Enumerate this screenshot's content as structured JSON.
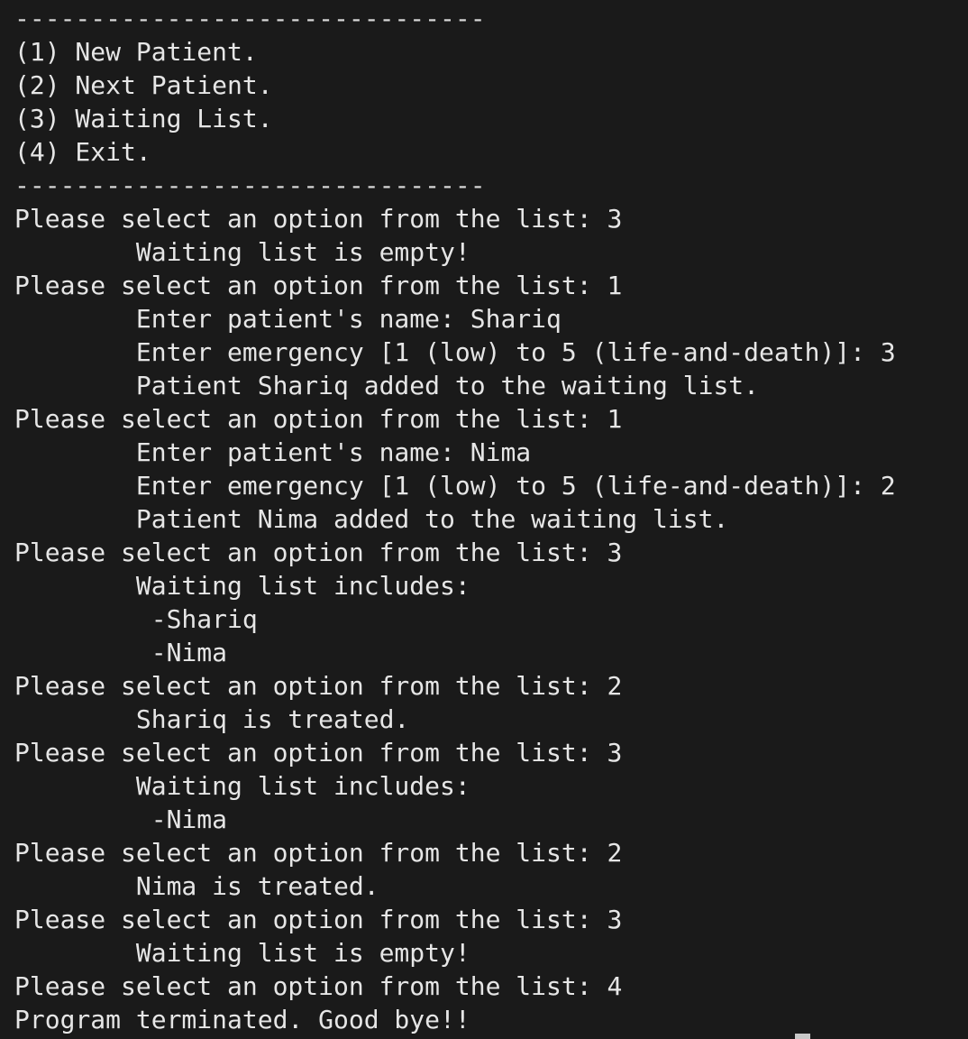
{
  "terminal": {
    "lines": [
      "-------------------------------",
      "(1) New Patient.",
      "(2) Next Patient.",
      "(3) Waiting List.",
      "(4) Exit.",
      "-------------------------------",
      "Please select an option from the list: 3",
      "        Waiting list is empty!",
      "Please select an option from the list: 1",
      "        Enter patient's name: Shariq",
      "        Enter emergency [1 (low) to 5 (life-and-death)]: 3",
      "        Patient Shariq added to the waiting list.",
      "Please select an option from the list: 1",
      "        Enter patient's name: Nima",
      "        Enter emergency [1 (low) to 5 (life-and-death)]: 2",
      "        Patient Nima added to the waiting list.",
      "Please select an option from the list: 3",
      "        Waiting list includes:",
      "         -Shariq",
      "         -Nima",
      "Please select an option from the list: 2",
      "        Shariq is treated.",
      "Please select an option from the list: 3",
      "        Waiting list includes:",
      "         -Nima",
      "Please select an option from the list: 2",
      "        Nima is treated.",
      "Please select an option from the list: 3",
      "        Waiting list is empty!",
      "Please select an option from the list: 4",
      "Program terminated. Good bye!!"
    ]
  }
}
